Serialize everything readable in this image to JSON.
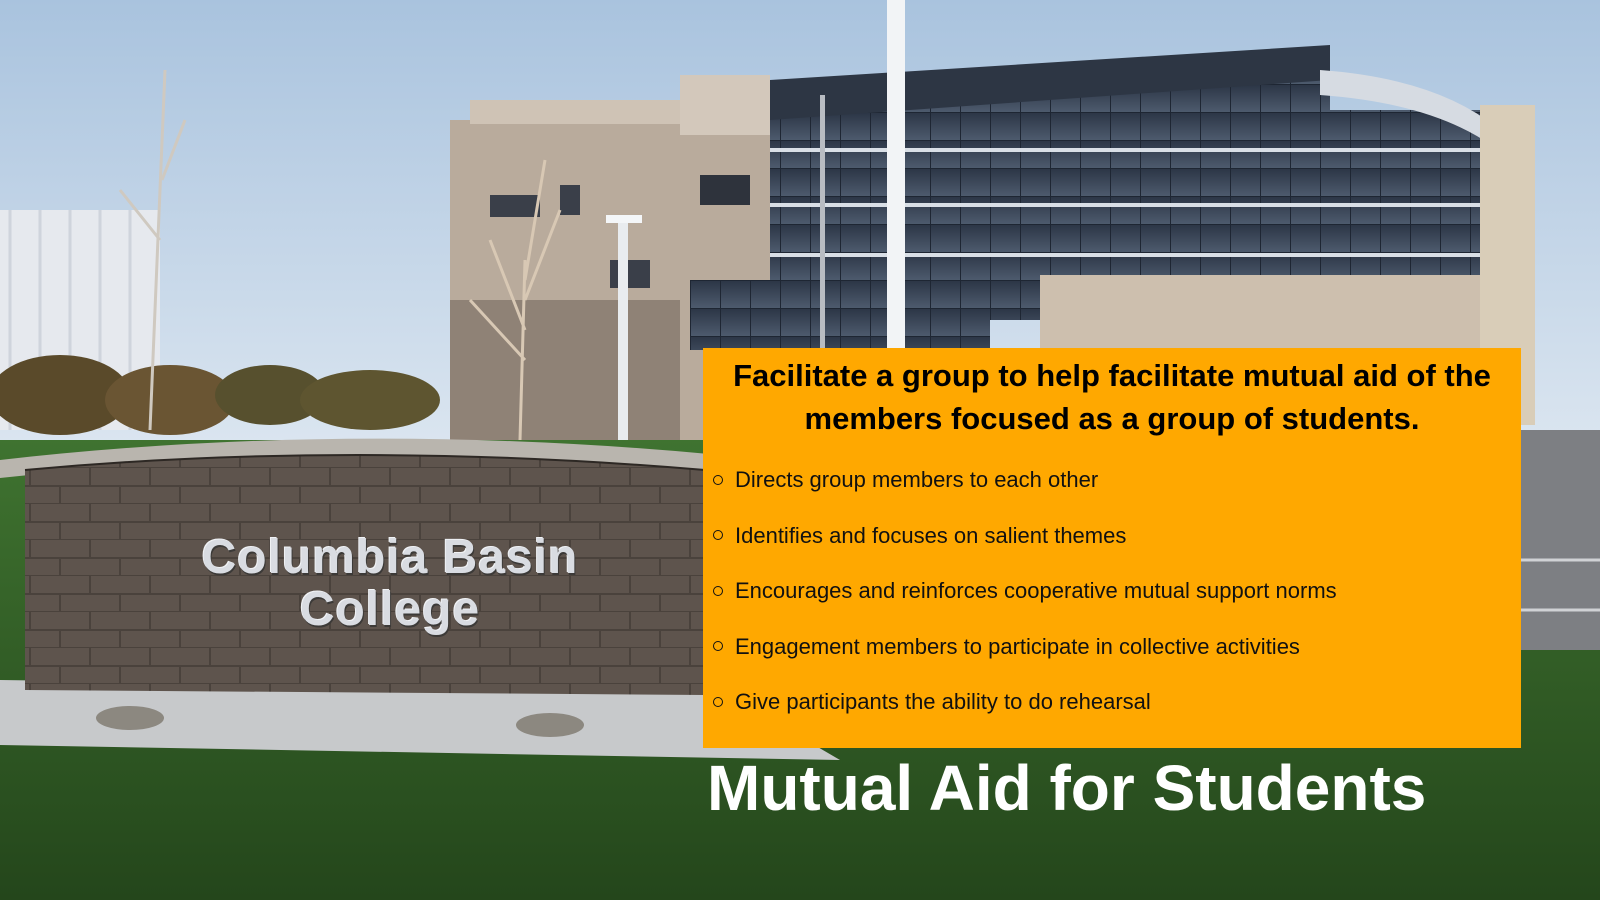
{
  "slide": {
    "title": "Mutual Aid for Students",
    "background": {
      "sign_line1": "Columbia Basin",
      "sign_line2": "College"
    },
    "card": {
      "heading": "Facilitate a group to help facilitate mutual aid of the members focused as a group of students.",
      "bullets": [
        "Directs group members to each other",
        "Identifies and focuses on salient themes",
        "Encourages and reinforces cooperative mutual support norms",
        "Engagement members to participate in collective activities",
        "Give participants the ability to do rehearsal"
      ]
    }
  },
  "colors": {
    "card": "#ffa800",
    "title": "#ffffff",
    "sky": "#c9d9ea",
    "grass": "#2f5a24"
  }
}
